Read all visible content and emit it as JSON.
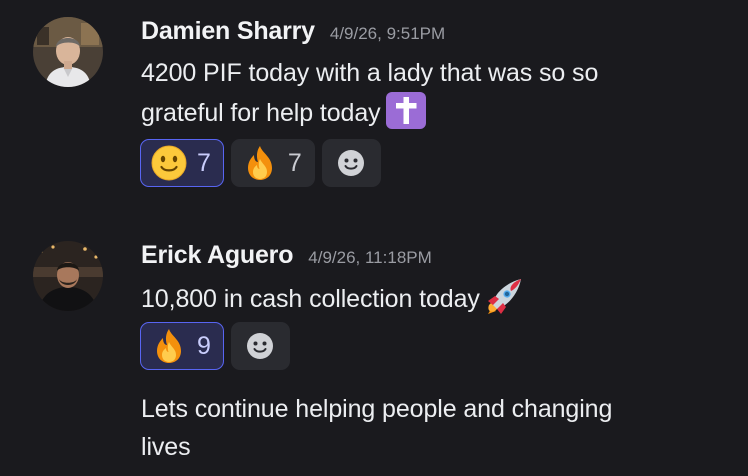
{
  "messages": [
    {
      "author": "Damien Sharry",
      "timestamp": "4/9/26, 9:51PM",
      "lines": [
        "4200 PIF today with a lady that was so so",
        "grateful for help today"
      ],
      "inline_emoji": "latin-cross-emoji",
      "reactions": [
        {
          "emoji": "slightly-smiling-face-emoji",
          "count": "7",
          "reacted_by_me": true
        },
        {
          "emoji": "fire-emoji",
          "count": "7",
          "reacted_by_me": false
        }
      ],
      "add_reaction_icon": "add-reaction-icon"
    },
    {
      "author": "Erick Aguero",
      "timestamp": "4/9/26, 11:18PM",
      "lines": [
        "10,800 in cash collection today"
      ],
      "inline_emoji": "rocket-emoji",
      "reactions": [
        {
          "emoji": "fire-emoji",
          "count": "9",
          "reacted_by_me": true
        }
      ],
      "add_reaction_icon": "add-reaction-icon",
      "followup_lines": [
        "Lets continue helping people and changing",
        "lives"
      ]
    }
  ],
  "colors": {
    "background": "#1a1a1e",
    "text": "#eceef1",
    "timestamp": "#9a9ca3",
    "reaction_bg": "#2a2b30",
    "reaction_me_bg": "#2a2c4f",
    "reaction_me_border": "#5865f2"
  }
}
